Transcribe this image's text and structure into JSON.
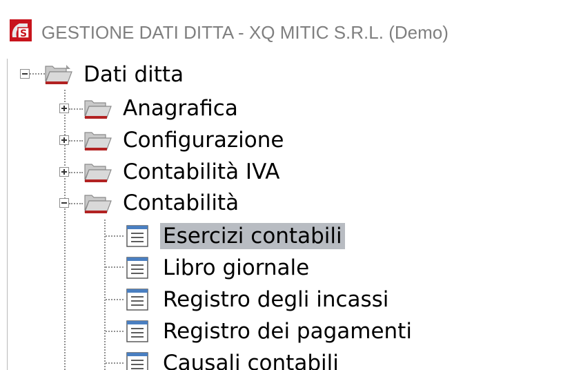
{
  "window": {
    "title": "GESTIONE DATI DITTA - XQ MITIC S.R.L.  (Demo)",
    "app_icon_letter": "S"
  },
  "tree": {
    "root": {
      "label": "Dati ditta",
      "expanded": true
    },
    "children": [
      {
        "label": "Anagrafica",
        "expanded": false
      },
      {
        "label": "Configurazione",
        "expanded": false
      },
      {
        "label": "Contabilità IVA",
        "expanded": false
      },
      {
        "label": "Contabilità",
        "expanded": true
      }
    ],
    "contabilita_items": [
      {
        "label": "Esercizi contabili",
        "selected": true
      },
      {
        "label": "Libro giornale",
        "selected": false
      },
      {
        "label": "Registro degli incassi",
        "selected": false
      },
      {
        "label": "Registro dei pagamenti",
        "selected": false
      },
      {
        "label": "Causali contabili",
        "selected": false
      }
    ]
  },
  "colors": {
    "folder_red": "#b22222",
    "selection_bg": "#b8bcc2",
    "doc_blue": "#4a7fc1"
  }
}
